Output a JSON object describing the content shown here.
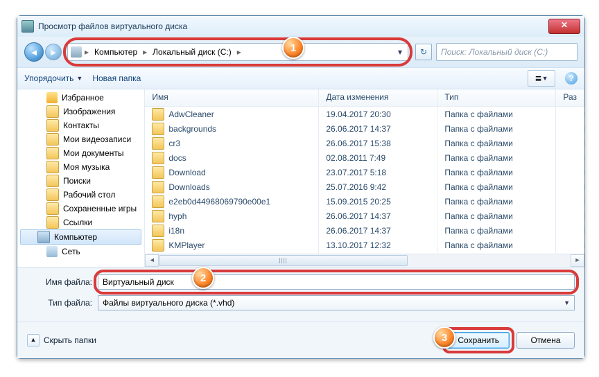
{
  "window": {
    "title": "Просмотр файлов виртуального диска"
  },
  "nav": {
    "crumbs": [
      "Компьютер",
      "Локальный диск (C:)"
    ],
    "search_placeholder": "Поиск: Локальный диск (C:)"
  },
  "toolbar": {
    "organize": "Упорядочить",
    "newfolder": "Новая папка"
  },
  "tree": {
    "items": [
      {
        "label": "Избранное",
        "cls": "ico-fav"
      },
      {
        "label": "Изображения",
        "cls": "ico-fld"
      },
      {
        "label": "Контакты",
        "cls": "ico-fld"
      },
      {
        "label": "Мои видеозаписи",
        "cls": "ico-fld"
      },
      {
        "label": "Мои документы",
        "cls": "ico-fld"
      },
      {
        "label": "Моя музыка",
        "cls": "ico-fld"
      },
      {
        "label": "Поиски",
        "cls": "ico-fld"
      },
      {
        "label": "Рабочий стол",
        "cls": "ico-fld"
      },
      {
        "label": "Сохраненные игры",
        "cls": "ico-fld"
      },
      {
        "label": "Ссылки",
        "cls": "ico-fld"
      },
      {
        "label": "Компьютер",
        "cls": "ico-pc",
        "sel": true
      },
      {
        "label": "Сеть",
        "cls": "ico-net"
      }
    ]
  },
  "columns": {
    "name": "Имя",
    "date": "Дата изменения",
    "type": "Тип",
    "size": "Раз"
  },
  "files": [
    {
      "name": "AdwCleaner",
      "date": "19.04.2017 20:30",
      "type": "Папка с файлами"
    },
    {
      "name": "backgrounds",
      "date": "26.06.2017 14:37",
      "type": "Папка с файлами"
    },
    {
      "name": "cr3",
      "date": "26.06.2017 15:38",
      "type": "Папка с файлами"
    },
    {
      "name": "docs",
      "date": "02.08.2011 7:49",
      "type": "Папка с файлами"
    },
    {
      "name": "Download",
      "date": "23.07.2017 5:18",
      "type": "Папка с файлами"
    },
    {
      "name": "Downloads",
      "date": "25.07.2016 9:42",
      "type": "Папка с файлами"
    },
    {
      "name": "e2eb0d44968069790e00e1",
      "date": "15.09.2015 20:25",
      "type": "Папка с файлами"
    },
    {
      "name": "hyph",
      "date": "26.06.2017 14:37",
      "type": "Папка с файлами"
    },
    {
      "name": "i18n",
      "date": "26.06.2017 14:37",
      "type": "Папка с файлами"
    },
    {
      "name": "KMPlayer",
      "date": "13.10.2017 12:32",
      "type": "Папка с файлами"
    }
  ],
  "form": {
    "name_lab": "Имя файла:",
    "name_val": "Виртуальный диск",
    "type_lab": "Тип файла:",
    "type_val": "Файлы виртуального диска (*.vhd)"
  },
  "footer": {
    "hide": "Скрыть папки",
    "save": "Сохранить",
    "cancel": "Отмена"
  },
  "markers": {
    "m1": "1",
    "m2": "2",
    "m3": "3"
  }
}
